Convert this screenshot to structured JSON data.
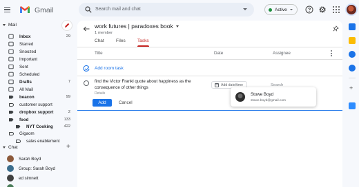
{
  "app": {
    "name": "Gmail"
  },
  "search": {
    "placeholder": "Search mail and chat"
  },
  "status": {
    "label": "Active",
    "color": "#1e8e3e"
  },
  "icons": {
    "menu": "hamburger-icon",
    "search": "search-icon",
    "help": "help-icon",
    "settings": "gear-icon",
    "apps": "apps-grid-icon",
    "compose": "pencil-icon",
    "back": "arrow-left-icon",
    "pin": "pin-icon",
    "add_task": "add-task-icon",
    "calendar": "calendar-icon"
  },
  "colors": {
    "accent": "#1a73e8",
    "tab_active": "#c5221f",
    "compose": "#c5221f",
    "active": "#1e8e3e"
  },
  "sidebar": {
    "mail_heading": "Mail",
    "items": [
      {
        "label": "Inbox",
        "count": "29",
        "bold": true,
        "icon": "inbox-icon"
      },
      {
        "label": "Starred",
        "count": "",
        "bold": false,
        "icon": "star-icon"
      },
      {
        "label": "Snoozed",
        "count": "",
        "bold": false,
        "icon": "clock-icon"
      },
      {
        "label": "Important",
        "count": "",
        "bold": false,
        "icon": "important-icon"
      },
      {
        "label": "Sent",
        "count": "",
        "bold": false,
        "icon": "send-icon"
      },
      {
        "label": "Scheduled",
        "count": "",
        "bold": false,
        "icon": "scheduled-icon"
      },
      {
        "label": "Drafts",
        "count": "7",
        "bold": true,
        "icon": "draft-icon"
      },
      {
        "label": "All Mail",
        "count": "",
        "bold": false,
        "icon": "mail-icon"
      },
      {
        "label": "beacon",
        "count": "99",
        "bold": true,
        "icon": "label-icon"
      },
      {
        "label": "customer support",
        "count": "",
        "bold": false,
        "icon": "label-outline-icon"
      },
      {
        "label": "dropbox support",
        "count": "2",
        "bold": true,
        "icon": "label-icon"
      },
      {
        "label": "food",
        "count": "133",
        "bold": true,
        "icon": "label-icon"
      },
      {
        "label": "NYT Cooking",
        "count": "422",
        "bold": true,
        "icon": "label-icon"
      },
      {
        "label": "Gigaom",
        "count": "",
        "bold": false,
        "icon": "label-outline-icon"
      },
      {
        "label": "sales enablement",
        "count": "",
        "bold": false,
        "icon": "label-outline-icon"
      }
    ],
    "chat_heading": "Chat",
    "chats": [
      {
        "label": "Sarah Boyd",
        "avatar_color": "#8d5a3c"
      },
      {
        "label": "Group: Sarah Boyd",
        "avatar_color": "#3c6e8d"
      },
      {
        "label": "ed simnett",
        "avatar_color": "#404040"
      },
      {
        "label": "",
        "avatar_color": "#4a7c59"
      }
    ]
  },
  "room": {
    "title": "work futures | paradoxes book",
    "members": "1 member",
    "tabs": [
      {
        "label": "Chat",
        "active": false
      },
      {
        "label": "Files",
        "active": false
      },
      {
        "label": "Tasks",
        "active": true
      }
    ],
    "columns": {
      "title": "Title",
      "date": "Date",
      "assignee": "Assignee"
    },
    "add_task_label": "Add room task",
    "task": {
      "text": "find the Victor Frankl quote about happiness as the consequence of other things",
      "details_placeholder": "Details",
      "date_button": "Add date/time",
      "assignee_placeholder": "Search"
    },
    "buttons": {
      "add": "Add",
      "cancel": "Cancel"
    },
    "assignee_suggestion": {
      "name": "Stowe Boyd",
      "email": "stowe.boyd@gmail.com"
    }
  },
  "rail": {
    "apps": [
      {
        "name": "calendar-app-icon",
        "color": "#1a73e8"
      },
      {
        "name": "keep-app-icon",
        "color": "#fbbc04"
      },
      {
        "name": "tasks-app-icon",
        "color": "#1a73e8"
      },
      {
        "name": "contacts-app-icon",
        "color": "#1a73e8"
      },
      {
        "name": "zoom-app-icon",
        "color": "#2d8cff"
      }
    ]
  }
}
